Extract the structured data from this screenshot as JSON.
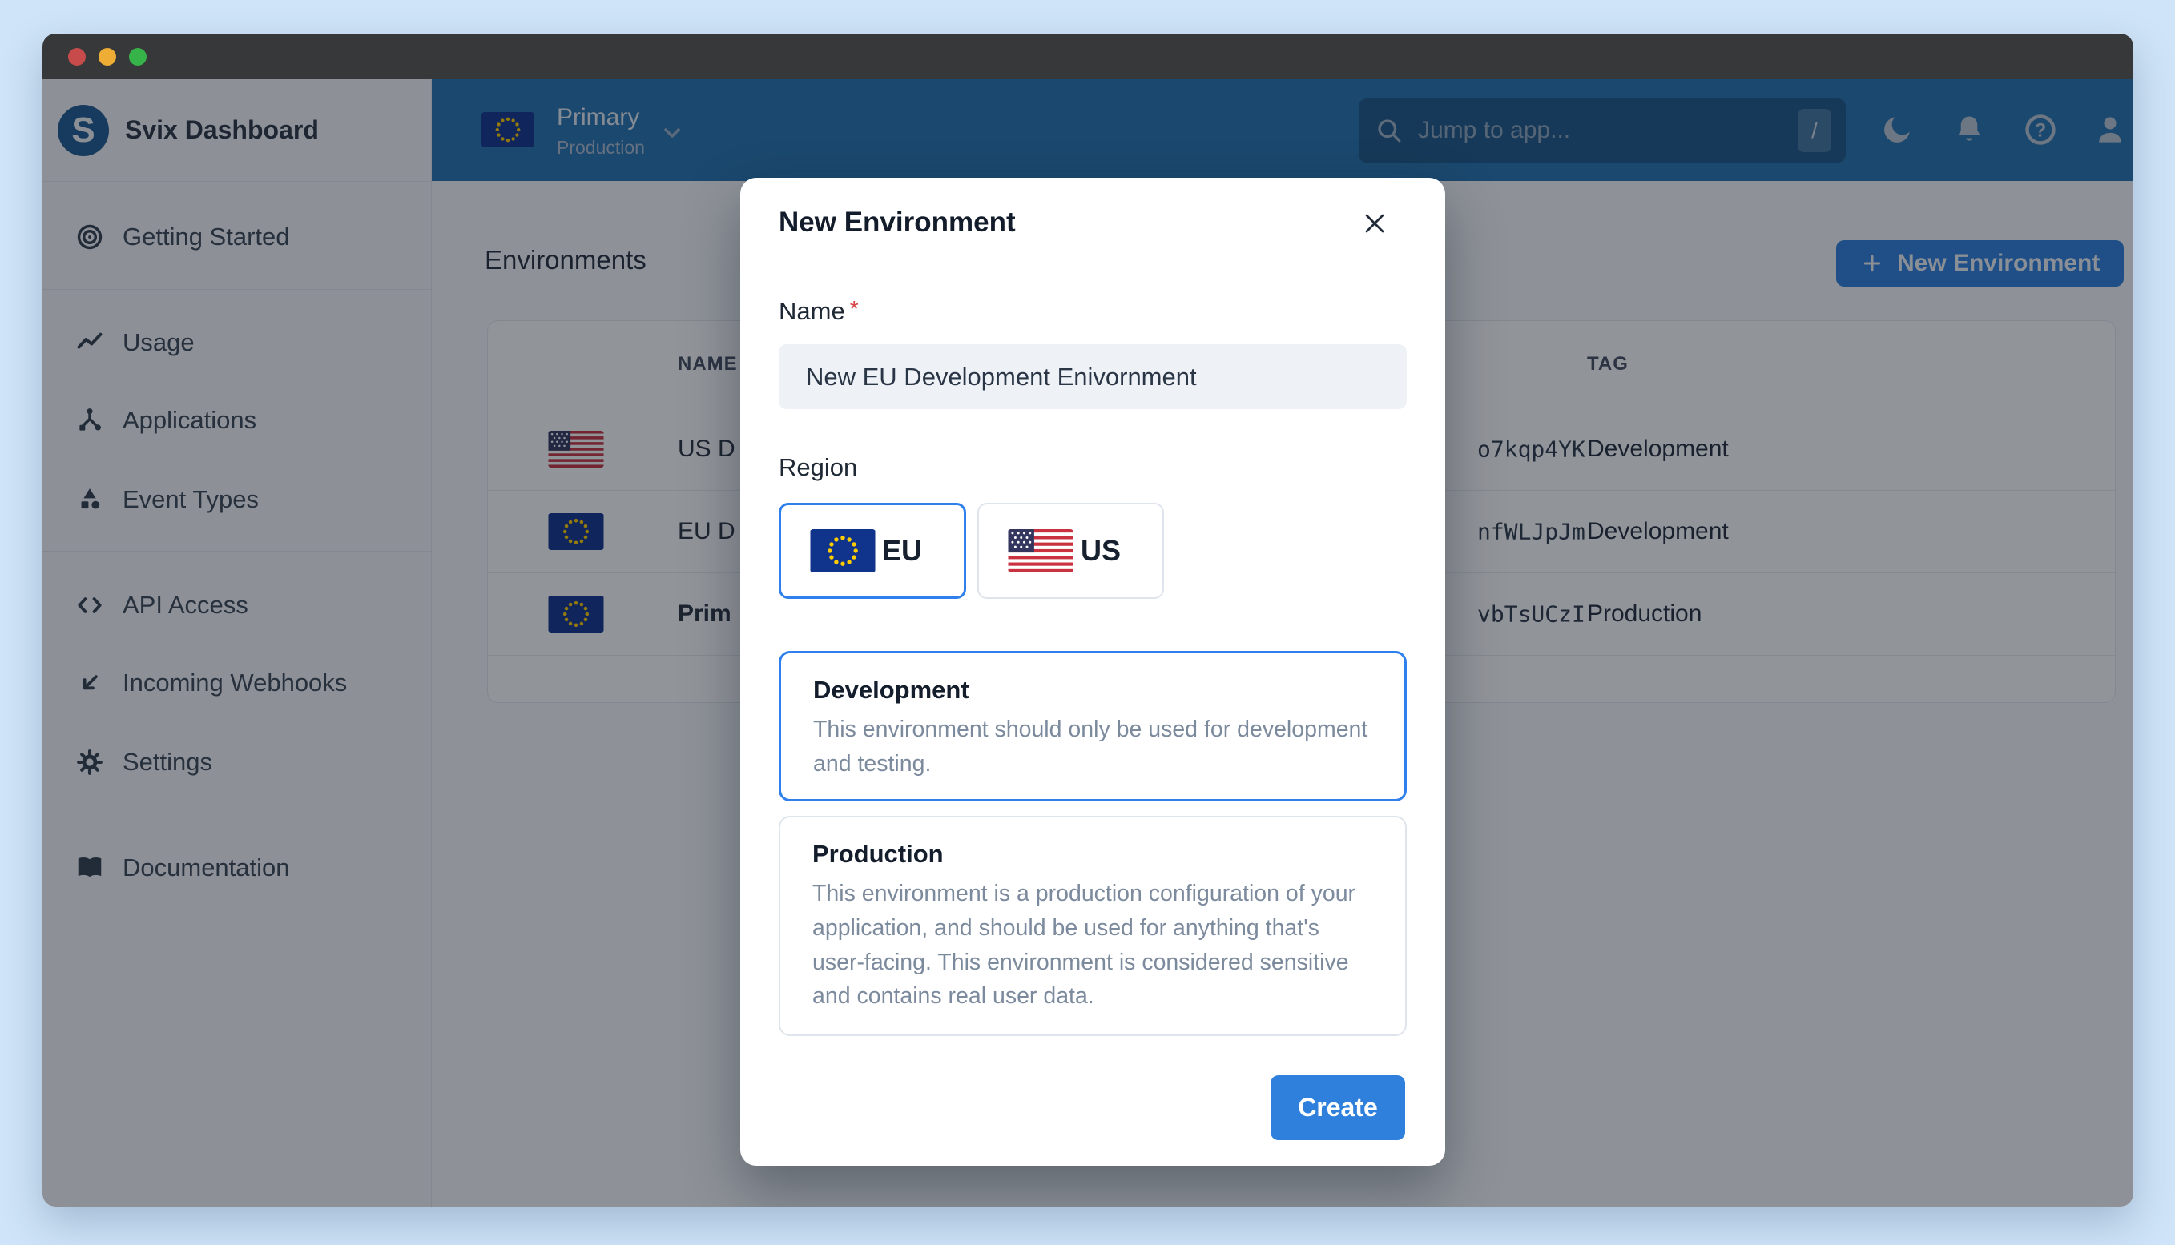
{
  "sidebar": {
    "logo_letter": "S",
    "title": "Svix Dashboard",
    "items": [
      {
        "label": "Getting Started"
      },
      {
        "label": "Usage"
      },
      {
        "label": "Applications"
      },
      {
        "label": "Event Types"
      },
      {
        "label": "API Access"
      },
      {
        "label": "Incoming Webhooks"
      },
      {
        "label": "Settings"
      },
      {
        "label": "Documentation"
      }
    ]
  },
  "topbar": {
    "environment": {
      "name": "Primary",
      "tag": "Production"
    },
    "search": {
      "placeholder": "Jump to app...",
      "shortcut": "/"
    }
  },
  "main": {
    "heading": "Environments",
    "new_environment_button": "New Environment",
    "table": {
      "headers": {
        "name": "NAME",
        "tag": "TAG"
      },
      "rows": [
        {
          "flag": "us",
          "name": "US D",
          "id": "o7kqp4YK",
          "tag": "Development"
        },
        {
          "flag": "eu",
          "name": "EU D",
          "id": "nfWLJpJm",
          "tag": "Development"
        },
        {
          "flag": "eu",
          "name": "Prim",
          "id": "vbTsUCzI",
          "tag": "Production"
        }
      ]
    }
  },
  "modal": {
    "title": "New Environment",
    "name": {
      "label": "Name",
      "required": "*",
      "value": "New EU Development Enivornment"
    },
    "region": {
      "label": "Region",
      "options": [
        {
          "label": "EU",
          "selected": true
        },
        {
          "label": "US",
          "selected": false
        }
      ]
    },
    "types": [
      {
        "title": "Development",
        "description": "This environment should only be used for development and testing.",
        "selected": true
      },
      {
        "title": "Production",
        "description": "This environment is a production configuration of your application, and should be used for anything that's user-facing. This environment is considered sensitive and contains real user data.",
        "selected": false
      }
    ],
    "create_button": "Create"
  },
  "colors": {
    "accent": "#2e80dc",
    "selected_border": "#2f80ed",
    "topbar": "#2673b0",
    "required_mark": "#d64545",
    "backdrop": "rgba(15,21,32,0.46)"
  }
}
